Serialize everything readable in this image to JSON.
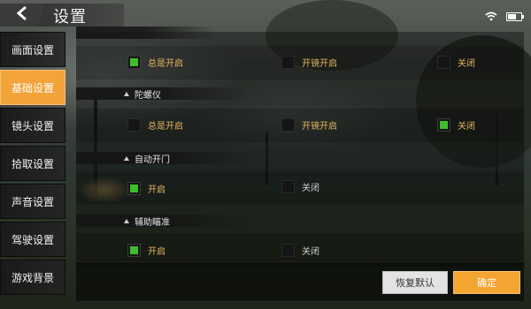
{
  "header": {
    "title": "设置"
  },
  "sidebar": {
    "items": [
      {
        "label": "画面设置"
      },
      {
        "label": "基础设置"
      },
      {
        "label": "镜头设置"
      },
      {
        "label": "拾取设置"
      },
      {
        "label": "声音设置"
      },
      {
        "label": "驾驶设置"
      },
      {
        "label": "游戏背景"
      }
    ],
    "active_index": 1
  },
  "sections": [
    {
      "title": "",
      "options": [
        {
          "label": "总是开启",
          "checked": true
        },
        {
          "label": "开镜开启",
          "checked": false
        },
        {
          "label": "关闭",
          "checked": false
        }
      ]
    },
    {
      "title": "陀螺仪",
      "options": [
        {
          "label": "总是开启",
          "checked": false
        },
        {
          "label": "开镜开启",
          "checked": false
        },
        {
          "label": "关闭",
          "checked": true
        }
      ]
    },
    {
      "title": "自动开门",
      "options": [
        {
          "label": "开启",
          "checked": true
        },
        {
          "label": "关闭",
          "checked": false
        }
      ]
    },
    {
      "title": "辅助瞄准",
      "options": [
        {
          "label": "开启",
          "checked": true
        },
        {
          "label": "关闭",
          "checked": false
        }
      ]
    }
  ],
  "footer": {
    "reset_label": "恢复默认",
    "confirm_label": "确定"
  },
  "colors": {
    "accent": "#f2a43a",
    "check": "#3fbd2c",
    "option_text": "#e6b562"
  }
}
